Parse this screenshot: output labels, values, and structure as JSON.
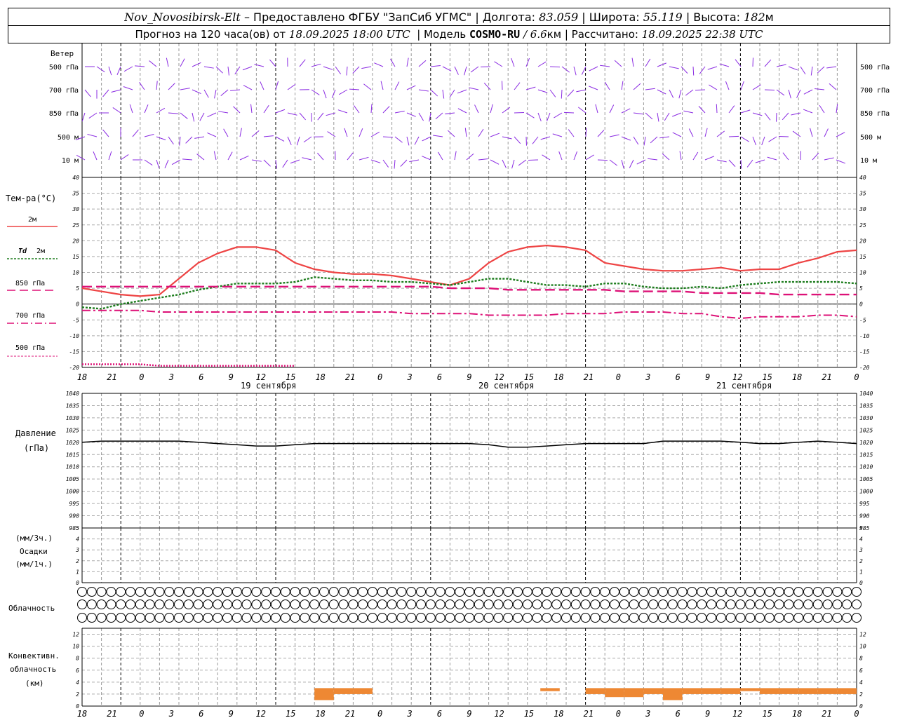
{
  "header": {
    "station": "Nov_Novosibirsk-Elt",
    "provided": " – Предоставлено ФГБУ \"ЗапСиб УГМС\" | Долгота: ",
    "lon": "83.059",
    "lat_label": " | Широта: ",
    "lat": "55.119",
    "alt_label": " | Высота: ",
    "alt": "182",
    "alt_unit": "м",
    "forecast": "Прогноз на 120 часа(ов) от ",
    "start": "18.09.2025 18:00 UTC",
    "model_label": "  | Модель ",
    "model": "COSMO-RU",
    "res": " / 6.6",
    "res_unit": "км",
    "calc_label": " | Рассчитано: ",
    "calc": "18.09.2025 22:38 UTC"
  },
  "labels": {
    "wind": "Ветер",
    "wind_levels": [
      "500 гПа",
      "700 гПа",
      "850 гПа",
      "500 м",
      "10  м"
    ],
    "temp": "Тем-ра(°С)",
    "t2m": "2м",
    "td": "Td",
    "td2m": "2м",
    "t850": "850 гПа",
    "t700": "700 гПа",
    "t500": "500 гПа",
    "pressure": "Давление",
    "pressure_unit": "(гПа)",
    "precip_u1": "(мм/3ч.)",
    "precip": "Осадки",
    "precip_u2": "(мм/1ч.)",
    "cloud": "Облачность",
    "conv1": "Конвективн.",
    "conv2": "облачность",
    "conv3": "(км)"
  },
  "x_ticks": [
    "18",
    "21",
    "0",
    "3",
    "6",
    "9",
    "12",
    "15",
    "18",
    "21",
    "0",
    "3",
    "6",
    "9",
    "12",
    "15",
    "18",
    "21",
    "0",
    "3",
    "6",
    "9",
    "12",
    "15",
    "18",
    "21",
    "0"
  ],
  "dates": [
    "19 сентября",
    "20 сентября",
    "21 сентября"
  ],
  "colors": {
    "wind": "#8a2be2",
    "t2m": "#ee4444",
    "td": "#1e7d1e",
    "t850": "#dd1177",
    "t700": "#dd1177",
    "t500": "#dd1177",
    "pressure": "#000000",
    "conv": "#ee8833"
  },
  "chart_data": {
    "type": "line",
    "hours": [
      0,
      3,
      6,
      9,
      12,
      15,
      18,
      21,
      24,
      27,
      30,
      33,
      36,
      39,
      42,
      45,
      48,
      51,
      54,
      57,
      60,
      63,
      66,
      69,
      72,
      75,
      78,
      81,
      84,
      87,
      90,
      93,
      96,
      99,
      102,
      105,
      108,
      111,
      114,
      117,
      120
    ],
    "temperature": {
      "ylim": [
        -20,
        40
      ],
      "ticks": [
        -20,
        -15,
        -10,
        -5,
        0,
        5,
        10,
        15,
        20,
        25,
        30,
        35,
        40
      ],
      "series": [
        {
          "name": "2м",
          "values": [
            5,
            4,
            3,
            2.5,
            3,
            8,
            13,
            16,
            18,
            18,
            17,
            13,
            11,
            10,
            9.5,
            9.5,
            9,
            8,
            7,
            6,
            8,
            13,
            16.5,
            18,
            18.5,
            18,
            17,
            13,
            12,
            11,
            10.5,
            10.5,
            11,
            11.5,
            10.5,
            11,
            11,
            13,
            14.5,
            16.5,
            17
          ]
        },
        {
          "name": "Td 2м",
          "values": [
            -1,
            -1.5,
            0,
            1,
            2,
            3,
            4.5,
            5.5,
            6.5,
            6.5,
            6.5,
            7,
            8.5,
            8,
            7.5,
            7.5,
            7,
            7,
            6.5,
            6,
            7,
            8,
            8,
            7,
            6,
            6,
            5.5,
            6.5,
            6.5,
            5.5,
            5,
            5,
            5.5,
            5,
            6,
            6.5,
            7,
            7,
            7,
            7,
            6.5
          ]
        },
        {
          "name": "850 гПа",
          "values": [
            5.5,
            5.5,
            5.5,
            5.5,
            5.5,
            5.5,
            5.5,
            5.5,
            5.5,
            5.5,
            5.5,
            5.5,
            5.5,
            5.5,
            5.5,
            5.5,
            5.5,
            5.5,
            5.5,
            5,
            5,
            5,
            4.5,
            4.5,
            4.5,
            4.5,
            4.5,
            4.5,
            4,
            4,
            4,
            4,
            3.5,
            3.5,
            3.5,
            3.5,
            3,
            3,
            3,
            3,
            3
          ]
        },
        {
          "name": "700 гПа",
          "values": [
            -2,
            -2,
            -2,
            -2,
            -2.5,
            -2.5,
            -2.5,
            -2.5,
            -2.5,
            -2.5,
            -2.5,
            -2.5,
            -2.5,
            -2.5,
            -2.5,
            -2.5,
            -2.5,
            -3,
            -3,
            -3,
            -3,
            -3.5,
            -3.5,
            -3.5,
            -3.5,
            -3,
            -3,
            -3,
            -2.5,
            -2.5,
            -2.5,
            -3,
            -3,
            -4,
            -4.5,
            -4,
            -4,
            -4,
            -3.5,
            -3.5,
            -4
          ]
        },
        {
          "name": "500 гПа",
          "values": [
            -19,
            -19,
            -19,
            -19,
            -19.5,
            -19.5,
            -19.5,
            -19.5,
            -19.5,
            -19.5,
            -19.5,
            -19.5,
            null,
            null,
            null,
            null,
            null,
            null,
            null,
            null,
            null,
            null,
            null,
            null,
            null,
            null,
            null,
            null,
            null,
            null,
            null,
            null,
            null,
            null,
            null,
            null,
            null,
            null,
            null,
            null,
            null
          ]
        }
      ]
    },
    "pressure": {
      "ylim": [
        985,
        1040
      ],
      "ticks": [
        985,
        990,
        995,
        1000,
        1005,
        1010,
        1015,
        1020,
        1025,
        1030,
        1035,
        1040
      ],
      "values": [
        1020,
        1020.5,
        1020.5,
        1020.5,
        1020.5,
        1020.5,
        1020,
        1019.5,
        1019,
        1018.5,
        1018.5,
        1019,
        1019.5,
        1019.5,
        1019.5,
        1019.5,
        1019.5,
        1019.5,
        1019.5,
        1019.5,
        1019.5,
        1019,
        1018,
        1018,
        1018.5,
        1019,
        1019.5,
        1019.5,
        1019.5,
        1019.5,
        1020.5,
        1020.5,
        1020.5,
        1020.5,
        1020,
        1019.5,
        1019.5,
        1020,
        1020.5,
        1020,
        1019.5
      ]
    },
    "precip": {
      "ylim": [
        0,
        5
      ],
      "ticks": [
        0,
        1,
        2,
        3,
        4,
        5
      ],
      "values": []
    },
    "convective_clouds": {
      "ylim": [
        0,
        13
      ],
      "ticks": [
        0,
        2,
        4,
        6,
        8,
        10,
        12
      ],
      "blocks": [
        {
          "start": 36,
          "end": 39,
          "bottom": 1,
          "top": 3
        },
        {
          "start": 39,
          "end": 42,
          "bottom": 2,
          "top": 3
        },
        {
          "start": 42,
          "end": 45,
          "bottom": 2,
          "top": 3
        },
        {
          "start": 71,
          "end": 74,
          "bottom": 2.5,
          "top": 3
        },
        {
          "start": 78,
          "end": 81,
          "bottom": 2,
          "top": 3
        },
        {
          "start": 81,
          "end": 84,
          "bottom": 1.5,
          "top": 3
        },
        {
          "start": 84,
          "end": 87,
          "bottom": 1.5,
          "top": 3
        },
        {
          "start": 87,
          "end": 90,
          "bottom": 2,
          "top": 3
        },
        {
          "start": 90,
          "end": 93,
          "bottom": 1,
          "top": 3
        },
        {
          "start": 93,
          "end": 96,
          "bottom": 2,
          "top": 3
        },
        {
          "start": 96,
          "end": 99,
          "bottom": 2,
          "top": 3
        },
        {
          "start": 99,
          "end": 102,
          "bottom": 2,
          "top": 3
        },
        {
          "start": 102,
          "end": 105,
          "bottom": 2.5,
          "top": 3
        },
        {
          "start": 105,
          "end": 108,
          "bottom": 2,
          "top": 3
        },
        {
          "start": 108,
          "end": 111,
          "bottom": 2,
          "top": 3
        },
        {
          "start": 111,
          "end": 114,
          "bottom": 2,
          "top": 3
        },
        {
          "start": 114,
          "end": 117,
          "bottom": 2,
          "top": 3
        },
        {
          "start": 117,
          "end": 120,
          "bottom": 2,
          "top": 3
        }
      ]
    },
    "cloud_rows": {
      "high": "0000000000000000000000000000000000000000000000000000000000000000000000000000000000000000000000000000000000000000000000000000000000000000000000000000000000000000000000000000000000000000000000000000000000000000000000000000000000000000000000000000000000000",
      "legend": "0 = clear, 1..4 = coverage quarters"
    },
    "cloud_coverage": {
      "upper": [
        0,
        0,
        0,
        0,
        0,
        0,
        0,
        0,
        0,
        0,
        0,
        0,
        0,
        0,
        0,
        0,
        0,
        0,
        0,
        0,
        0,
        0,
        0,
        0,
        0,
        0,
        0,
        0,
        0,
        0,
        0,
        0,
        0,
        0,
        0,
        0,
        0,
        0,
        0,
        0,
        0,
        0,
        0,
        0,
        0,
        0,
        0,
        0,
        0,
        0,
        0,
        0,
        0,
        0,
        0,
        0,
        0,
        0,
        0,
        0,
        0,
        0,
        0,
        0,
        0,
        0,
        0,
        0,
        0,
        0,
        0,
        0,
        0,
        0,
        0,
        0,
        0,
        0,
        0,
        0,
        0,
        0,
        0,
        0,
        0,
        0,
        0,
        0,
        0,
        0,
        0,
        0,
        0,
        0,
        0,
        0,
        0,
        0,
        0,
        0,
        0,
        0,
        0,
        0,
        0,
        0,
        0,
        0,
        0,
        0,
        0,
        0,
        0,
        0,
        0,
        0,
        0,
        0,
        0,
        0,
        0
      ],
      "middle": [
        0,
        0,
        0,
        0,
        0,
        0,
        0,
        0,
        0,
        0,
        0,
        0,
        0,
        0,
        0,
        0,
        0,
        0,
        0,
        0,
        0,
        0,
        0,
        0,
        0,
        0,
        0,
        0,
        0,
        0,
        0,
        0,
        0,
        0,
        0,
        0,
        0,
        0,
        0,
        0,
        0,
        0,
        0,
        0,
        0,
        0,
        0,
        0,
        0,
        0,
        0,
        0,
        0,
        0,
        0,
        0,
        0,
        0,
        0,
        0,
        0,
        0,
        0,
        0,
        0,
        0,
        0,
        0,
        0,
        0,
        0,
        0,
        0,
        0,
        0,
        0,
        0,
        0,
        0,
        0,
        0,
        0,
        0,
        0,
        0,
        0,
        0,
        0,
        0,
        0,
        0,
        0,
        0,
        0,
        0,
        0,
        0,
        0,
        0,
        0,
        0,
        0,
        0,
        0,
        0,
        0,
        0,
        0,
        0,
        0,
        0,
        0,
        0,
        0,
        0,
        0,
        0,
        0,
        0,
        0,
        0
      ],
      "lower": [
        0,
        0,
        0,
        0,
        0,
        0,
        0,
        0,
        0,
        0,
        0,
        0,
        0,
        0,
        0,
        0,
        0,
        0,
        0,
        0,
        0,
        0,
        0,
        0,
        0,
        0,
        0,
        0,
        0,
        0,
        0,
        0,
        0,
        0,
        0,
        0,
        0,
        0,
        0,
        0,
        0,
        0,
        0,
        0,
        0,
        0,
        0,
        0,
        0,
        0,
        0,
        0,
        0,
        0,
        0,
        0,
        0,
        0,
        0,
        0,
        0,
        0,
        0,
        0,
        0,
        0,
        0,
        0,
        0,
        0,
        0,
        0,
        0,
        0,
        0,
        0,
        0,
        0,
        0,
        0,
        0,
        0,
        0,
        0,
        0,
        0,
        0,
        0,
        0,
        0,
        0,
        0,
        0,
        0,
        0,
        0,
        0,
        0,
        0,
        0,
        0,
        0,
        0,
        0,
        0,
        0,
        0,
        0,
        0,
        0,
        0,
        0,
        0,
        0,
        0,
        0,
        0,
        0,
        0,
        0,
        0
      ]
    }
  }
}
